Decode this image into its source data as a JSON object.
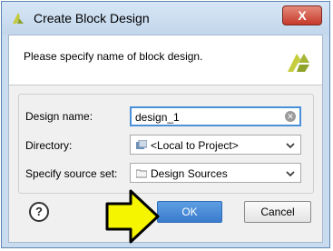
{
  "window": {
    "title": "Create Block Design",
    "close_label": "X"
  },
  "banner": {
    "text": "Please specify name of block design."
  },
  "form": {
    "design_name": {
      "label": "Design name:",
      "value": "design_1"
    },
    "directory": {
      "label": "Directory:",
      "value": "<Local to Project>",
      "icon": "folder-local-icon"
    },
    "source_set": {
      "label": "Specify source set:",
      "value": "Design Sources",
      "icon": "folder-icon"
    }
  },
  "buttons": {
    "help": "?",
    "ok": "OK",
    "cancel": "Cancel"
  },
  "colors": {
    "accent": "#3a7ccc",
    "arrow_fill": "#f5f500",
    "logo": "#b7c63b"
  }
}
